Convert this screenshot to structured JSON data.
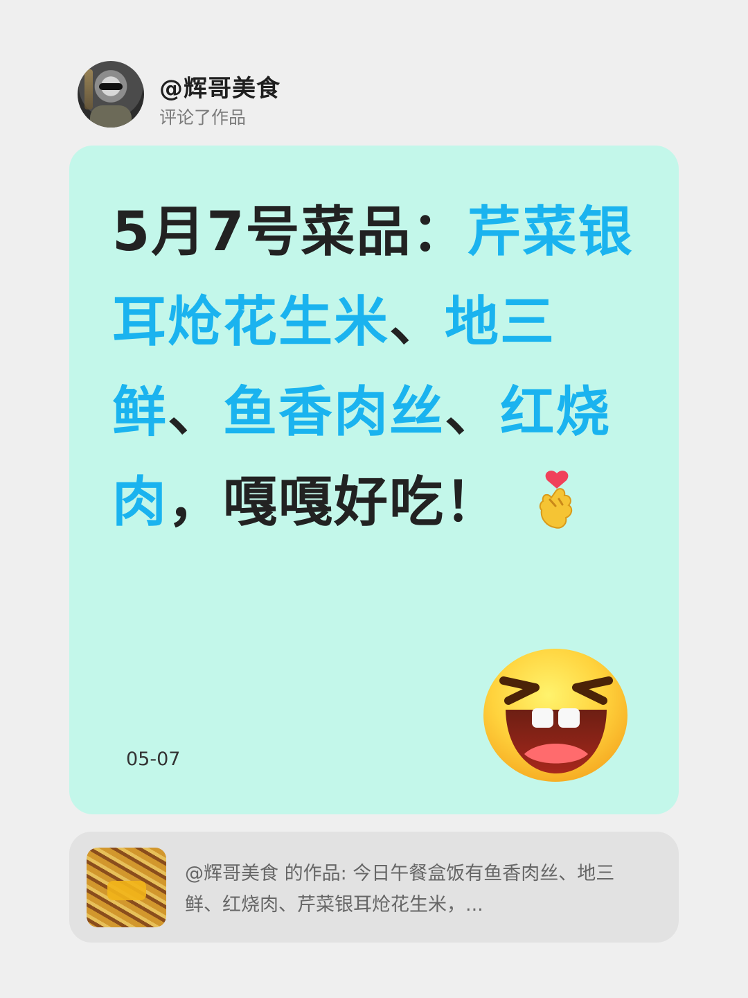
{
  "header": {
    "username": "@辉哥美食",
    "action": "评论了作品"
  },
  "comment": {
    "segments": [
      {
        "text": "5月7号菜品：",
        "style": "normal"
      },
      {
        "text": "芹菜银耳炝花生米",
        "style": "highlight"
      },
      {
        "text": "、",
        "style": "normal"
      },
      {
        "text": "地三鲜",
        "style": "highlight"
      },
      {
        "text": "、",
        "style": "normal"
      },
      {
        "text": "鱼香肉丝",
        "style": "highlight"
      },
      {
        "text": "、",
        "style": "normal"
      },
      {
        "text": "红烧肉",
        "style": "highlight"
      },
      {
        "text": "，嘎嘎好吃！",
        "style": "normal"
      }
    ],
    "date": "05-07"
  },
  "preview": {
    "text": "@辉哥美食 的作品: 今日午餐盒饭有鱼香肉丝、地三鲜、红烧肉、芹菜银耳炝花生米，..."
  },
  "icons": {
    "heart_hand": "finger-heart-icon",
    "laughing_face": "laughing-face-icon"
  },
  "colors": {
    "background": "#efefef",
    "card_background": "#c3f7ea",
    "highlight": "#1ab3ef",
    "preview_background": "#e2e2e2"
  }
}
